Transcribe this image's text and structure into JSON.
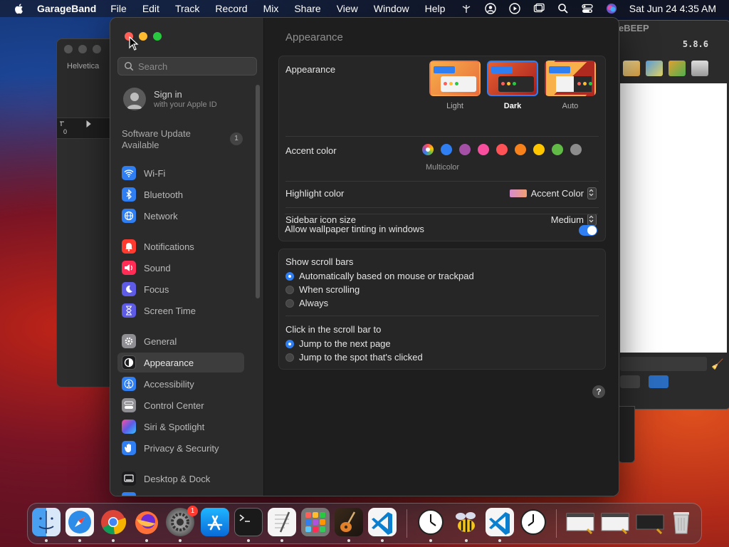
{
  "menubar": {
    "app_name": "GarageBand",
    "menus": [
      "File",
      "Edit",
      "Track",
      "Record",
      "Mix",
      "Share",
      "View",
      "Window",
      "Help"
    ],
    "status_icons": [
      "antenna-icon",
      "user-icon",
      "play-circle-icon",
      "window-icon",
      "search-icon",
      "control-center-icon",
      "siri-icon"
    ],
    "clock": "Sat Jun 24  4:35 AM"
  },
  "bg_left_window": {
    "font_label": "Helvetica",
    "ruler_zero": "0"
  },
  "bg_right_window": {
    "title": "eBEEP",
    "version": "5.8.6"
  },
  "sidebar": {
    "search_placeholder": "Search",
    "signin_title": "Sign in",
    "signin_subtitle": "with your Apple ID",
    "update_label": "Software Update Available",
    "update_badge": "1",
    "items": [
      {
        "label": "Wi-Fi",
        "icon": "wifi-icon",
        "color": "#2f7ff3"
      },
      {
        "label": "Bluetooth",
        "icon": "bluetooth-icon",
        "color": "#2f7ff3"
      },
      {
        "label": "Network",
        "icon": "globe-icon",
        "color": "#2f7ff3"
      },
      {
        "label": "Notifications",
        "icon": "bell-icon",
        "color": "#ff3b30"
      },
      {
        "label": "Sound",
        "icon": "speaker-icon",
        "color": "#ff2d55"
      },
      {
        "label": "Focus",
        "icon": "moon-icon",
        "color": "#5e5ce6"
      },
      {
        "label": "Screen Time",
        "icon": "hourglass-icon",
        "color": "#5e5ce6"
      },
      {
        "label": "General",
        "icon": "gear-icon",
        "color": "#8e8e93"
      },
      {
        "label": "Appearance",
        "icon": "appearance-icon",
        "color": "#1c1c1e"
      },
      {
        "label": "Accessibility",
        "icon": "accessibility-icon",
        "color": "#2f7ff3"
      },
      {
        "label": "Control Center",
        "icon": "control-center-icon",
        "color": "#8e8e93"
      },
      {
        "label": "Siri & Spotlight",
        "icon": "siri-icon",
        "color": "#af52de"
      },
      {
        "label": "Privacy & Security",
        "icon": "hand-icon",
        "color": "#2f7ff3"
      },
      {
        "label": "Desktop & Dock",
        "icon": "desktop-icon",
        "color": "#1c1c1e"
      }
    ],
    "selected": "Appearance"
  },
  "content": {
    "title": "Appearance",
    "appearance_label": "Appearance",
    "themes": [
      {
        "label": "Light",
        "selected": false
      },
      {
        "label": "Dark",
        "selected": true
      },
      {
        "label": "Auto",
        "selected": false
      }
    ],
    "accent_label": "Accent color",
    "accent_caption": "Multicolor",
    "accent_colors": [
      "multicolor",
      "#2f7ff3",
      "#a550a7",
      "#f74f9e",
      "#ff5257",
      "#f7821b",
      "#ffc600",
      "#62ba46",
      "#8c8c8c"
    ],
    "accent_selected": "multicolor",
    "highlight_label": "Highlight color",
    "highlight_value": "Accent Color",
    "icon_size_label": "Sidebar icon size",
    "icon_size_value": "Medium",
    "tinting_label": "Allow wallpaper tinting in windows",
    "tinting_on": true,
    "scrollbars_label": "Show scroll bars",
    "scrollbar_options": [
      "Automatically based on mouse or trackpad",
      "When scrolling",
      "Always"
    ],
    "scrollbar_selected": 0,
    "click_label": "Click in the scroll bar to",
    "click_options": [
      "Jump to the next page",
      "Jump to the spot that's clicked"
    ],
    "click_selected": 0,
    "help": "?"
  },
  "dock": {
    "apps": [
      "Finder",
      "Safari",
      "Chrome",
      "Firefox",
      "System Settings",
      "App Store",
      "Terminal",
      "TextEdit",
      "Launchpad",
      "GarageBand",
      "Visual Studio Code",
      "Clock",
      "Bee",
      "Visual Studio Code",
      "Clock",
      "Window",
      "Window",
      "Window",
      "Trash"
    ],
    "settings_badge": "1"
  }
}
